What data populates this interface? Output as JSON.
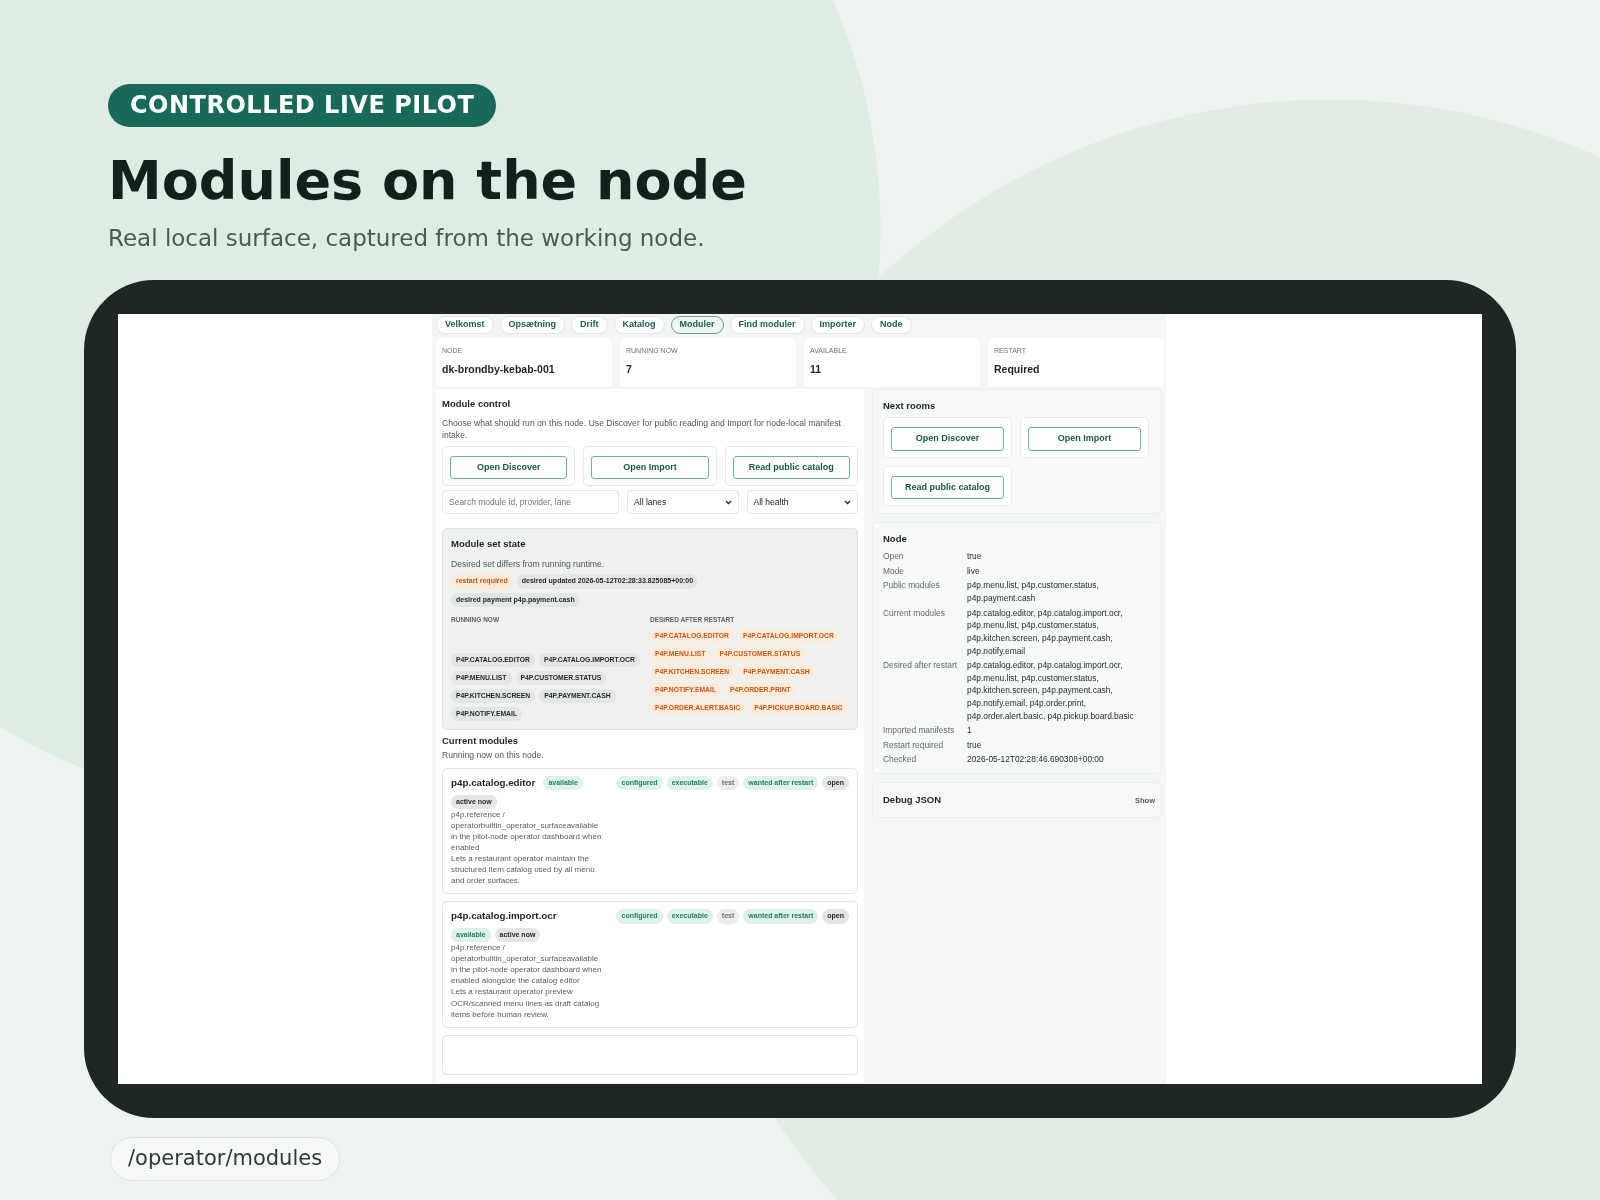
{
  "header": {
    "badge": "CONTROLLED LIVE PILOT",
    "title": "Modules on the node",
    "subtitle": "Real local surface, captured from the working node."
  },
  "screen": {
    "tabs": [
      {
        "label": "Velkomst",
        "selected": false
      },
      {
        "label": "Opsætning",
        "selected": false
      },
      {
        "label": "Drift",
        "selected": false
      },
      {
        "label": "Katalog",
        "selected": false
      },
      {
        "label": "Moduler",
        "selected": true
      },
      {
        "label": "Find moduler",
        "selected": false
      },
      {
        "label": "Importer",
        "selected": false
      },
      {
        "label": "Node",
        "selected": false
      }
    ],
    "stats": [
      {
        "label": "NODE",
        "value": "dk-brondby-kebab-001"
      },
      {
        "label": "RUNNING NOW",
        "value": "7"
      },
      {
        "label": "AVAILABLE",
        "value": "11"
      },
      {
        "label": "RESTART",
        "value": "Required"
      }
    ],
    "module_control": {
      "title": "Module control",
      "description": "Choose what should run on this node. Use Discover for public reading and Import for node-local manifest intake.",
      "buttons": [
        "Open Discover",
        "Open Import",
        "Read public catalog"
      ],
      "search": {
        "placeholder": "Search module id, provider, lane"
      },
      "filters": [
        "All lanes",
        "All health"
      ]
    },
    "module_set_state": {
      "title": "Module set state",
      "message": "Desired set differs from running runtime.",
      "tags": [
        {
          "text": "restart required",
          "kind": "warn"
        },
        {
          "text": "desired updated 2026-05-12T02:28:33.825085+00:00",
          "kind": "dark"
        },
        {
          "text": "desired payment p4p.payment.cash",
          "kind": "dark"
        }
      ],
      "running_label": "RUNNING NOW",
      "running": [
        "P4P.CATALOG.EDITOR",
        "P4P.CATALOG.IMPORT.OCR",
        "P4P.MENU.LIST",
        "P4P.CUSTOMER.STATUS",
        "P4P.KITCHEN.SCREEN",
        "P4P.PAYMENT.CASH",
        "P4P.NOTIFY.EMAIL"
      ],
      "desired_label": "DESIRED AFTER RESTART",
      "desired": [
        "P4P.CATALOG.EDITOR",
        "P4P.CATALOG.IMPORT.OCR",
        "P4P.MENU.LIST",
        "P4P.CUSTOMER.STATUS",
        "P4P.KITCHEN.SCREEN",
        "P4P.PAYMENT.CASH",
        "P4P.NOTIFY.EMAIL",
        "P4P.ORDER.PRINT",
        "P4P.ORDER.ALERT.BASIC",
        "P4P.PICKUP.BOARD.BASIC"
      ]
    },
    "current_modules": {
      "title": "Current modules",
      "subtitle": "Running now on this node.",
      "modules": [
        {
          "id": "p4p.catalog.editor",
          "tags": [
            {
              "text": "available",
              "kind": "green"
            }
          ],
          "flags": [
            {
              "text": "configured",
              "kind": "green"
            },
            {
              "text": "executable",
              "kind": "green"
            },
            {
              "text": "test",
              "kind": "grey"
            },
            {
              "text": "wanted after restart",
              "kind": "green"
            },
            {
              "text": "open",
              "kind": "dark"
            }
          ],
          "more_tags": [
            {
              "text": "active now",
              "kind": "dark"
            }
          ],
          "paragraphs": [
            "p4p.reference / operatorbuiltin_operator_surfaceavailable in the pilot-node operator dashboard when enabled",
            "Lets a restaurant operator maintain the structured item catalog used by all menu and order surfaces."
          ]
        },
        {
          "id": "p4p.catalog.import.ocr",
          "flags": [
            {
              "text": "configured",
              "kind": "green"
            },
            {
              "text": "executable",
              "kind": "green"
            },
            {
              "text": "test",
              "kind": "grey"
            },
            {
              "text": "wanted after restart",
              "kind": "green"
            },
            {
              "text": "open",
              "kind": "dark"
            }
          ],
          "more_tags": [
            {
              "text": "available",
              "kind": "green"
            },
            {
              "text": "active now",
              "kind": "dark"
            }
          ],
          "paragraphs": [
            "p4p.reference / operatorbuiltin_operator_surfaceavailable in the pilot-node operator dashboard when enabled alongside the catalog editor",
            "Lets a restaurant operator preview OCR/scanned menu lines as draft catalog items before human review."
          ]
        }
      ]
    },
    "next_rooms": {
      "title": "Next rooms",
      "buttons": [
        "Open Discover",
        "Open Import",
        "Read public catalog"
      ]
    },
    "node": {
      "title": "Node",
      "rows": [
        {
          "label": "Open",
          "value": "true"
        },
        {
          "label": "Mode",
          "value": "live"
        },
        {
          "label": "Public modules",
          "value": "p4p.menu.list, p4p.customer.status, p4p.payment.cash"
        },
        {
          "label": "Current modules",
          "value": "p4p.catalog.editor, p4p.catalog.import.ocr, p4p.menu.list, p4p.customer.status, p4p.kitchen.screen, p4p.payment.cash, p4p.notify.email"
        },
        {
          "label": "Desired after restart",
          "value": "p4p.catalog.editor, p4p.catalog.import.ocr, p4p.menu.list, p4p.customer.status, p4p.kitchen.screen, p4p.payment.cash, p4p.notify.email, p4p.order.print, p4p.order.alert.basic, p4p.pickup.board.basic"
        },
        {
          "label": "Imported manifests",
          "value": "1"
        },
        {
          "label": "Restart required",
          "value": "true"
        },
        {
          "label": "Checked",
          "value": "2026-05-12T02:28:46.690308+00:00"
        }
      ]
    },
    "debug": {
      "title": "Debug JSON",
      "toggle": "Show"
    }
  },
  "route": "/operator/modules"
}
